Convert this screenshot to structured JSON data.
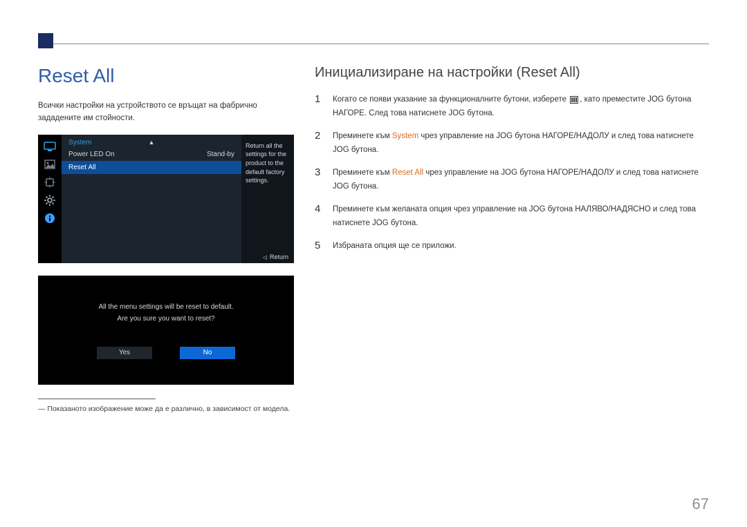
{
  "left": {
    "title": "Reset All",
    "description": "Всички настройки на устройството се връщат на фабрично зададените им стойности.",
    "osd": {
      "category": "System",
      "rows": [
        {
          "label": "Power LED On",
          "value": "Stand-by",
          "selected": false
        },
        {
          "label": "Reset All",
          "value": "",
          "selected": true
        }
      ],
      "help": "Return all the settings for the product to the default factory settings.",
      "return_label": "Return"
    },
    "dialog": {
      "line1": "All the menu settings will be reset to default.",
      "line2": "Are you sure you want to reset?",
      "yes": "Yes",
      "no": "No"
    },
    "footnote": "― Показаното изображение може да е различно, в зависимост от модела."
  },
  "right": {
    "title": "Инициализиране на настройки (Reset All)",
    "steps": [
      {
        "n": "1",
        "pre": "Когато се появи указание за функционалните бутони, изберете ",
        "post": ", като преместите JOG бутона НАГОРЕ. След това натиснете JOG бутона."
      },
      {
        "n": "2",
        "pre": "Преминете към ",
        "kw": "System",
        "post": " чрез управление на JOG бутона НАГОРЕ/НАДОЛУ и след това натиснете JOG бутона."
      },
      {
        "n": "3",
        "pre": "Преминете към ",
        "kw": "Reset All",
        "post": " чрез управление на JOG бутона НАГОРЕ/НАДОЛУ и след това натиснете JOG бутона."
      },
      {
        "n": "4",
        "text": "Преминете към желаната опция чрез управление на JOG бутона НАЛЯВО/НАДЯСНО и след това натиснете JOG бутона."
      },
      {
        "n": "5",
        "text": "Избраната опция ще се приложи."
      }
    ]
  },
  "page_number": "67"
}
